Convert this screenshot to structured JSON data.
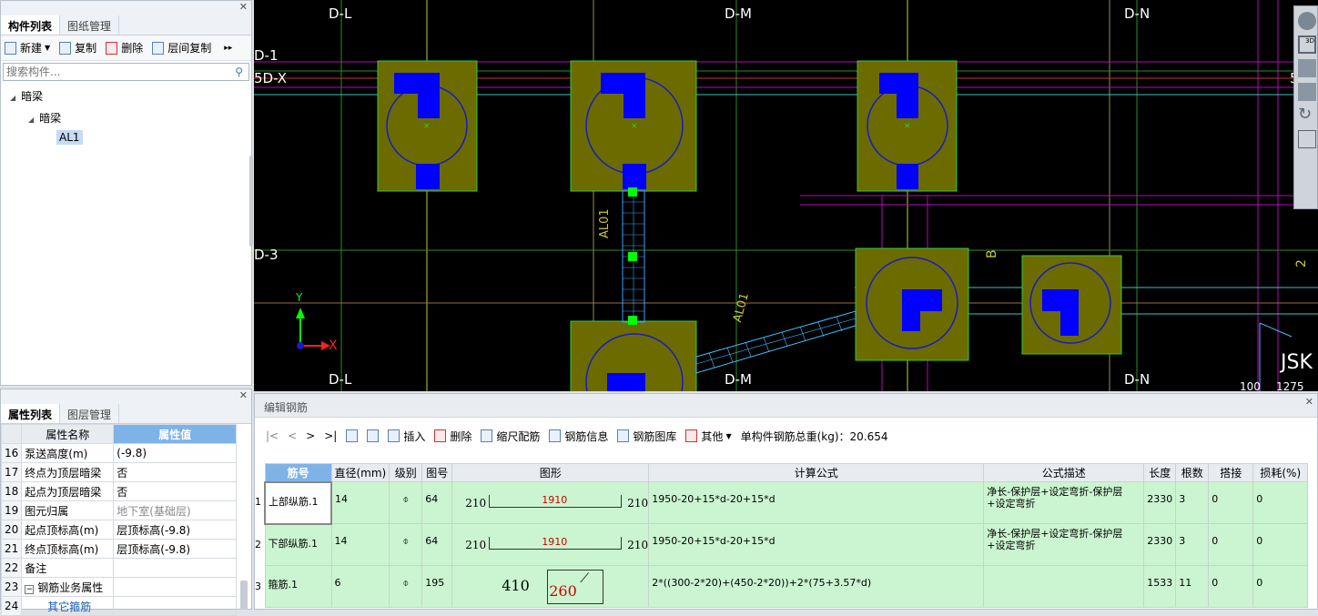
{
  "left_top": {
    "tabs": [
      "构件列表",
      "图纸管理"
    ],
    "toolbar": {
      "new": "新建",
      "copy": "复制",
      "delete": "删除",
      "floor_copy": "层间复制"
    },
    "search_placeholder": "搜索构件...",
    "tree": {
      "root": "暗梁",
      "child": "暗梁",
      "leaf": "AL1"
    }
  },
  "left_bottom": {
    "tabs": [
      "属性列表",
      "图层管理"
    ],
    "header": {
      "name": "属性名称",
      "value": "属性值"
    },
    "rows": [
      {
        "num": "16",
        "name": "泵送高度(m)",
        "value": "(-9.8)"
      },
      {
        "num": "17",
        "name": "终点为顶层暗梁",
        "value": "否"
      },
      {
        "num": "18",
        "name": "起点为顶层暗梁",
        "value": "否"
      },
      {
        "num": "19",
        "name": "图元归属",
        "value": "地下室(基础层)"
      },
      {
        "num": "20",
        "name": "起点顶标高(m)",
        "value": "层顶标高(-9.8)"
      },
      {
        "num": "21",
        "name": "终点顶标高(m)",
        "value": "层顶标高(-9.8)"
      },
      {
        "num": "22",
        "name": "备注",
        "value": ""
      },
      {
        "num": "23",
        "name": "钢筋业务属性",
        "value": ""
      },
      {
        "num": "24",
        "name": "其它箍筋",
        "value": ""
      }
    ]
  },
  "canvas": {
    "labels": {
      "dl_top": "D-L",
      "dm_top": "D-M",
      "dn_top": "D-N",
      "d1": "D-1",
      "d5x": "5D-X",
      "d3": "D-3",
      "dl_bot": "D-L",
      "dm_bot": "D-M",
      "dn_bot": "D-N",
      "al01_v": "AL01",
      "al01_d": "AL01",
      "jsk": "JSK",
      "b_mark": "B",
      "two_mark": "2",
      "five_mark": "5",
      "dim1": "100",
      "dim2": "1275",
      "axis_x": "X",
      "axis_y": "Y"
    },
    "colors": {
      "bg": "#000000",
      "pile": "#6b6b00",
      "pile_edge": "#2ecc40",
      "rebar": "#0000ff",
      "axis": "#c8c832"
    }
  },
  "editor": {
    "title": "编辑钢筋",
    "toolbar": {
      "nav": [
        "|<",
        "<",
        ">",
        ">|"
      ],
      "insert": "插入",
      "delete": "删除",
      "scale": "缩尺配筋",
      "info": "钢筋信息",
      "library": "钢筋图库",
      "other": "其他",
      "total": "单构件钢筋总重(kg)：20.654"
    },
    "columns": [
      "筋号",
      "直径(mm)",
      "级别",
      "图号",
      "图形",
      "计算公式",
      "公式描述",
      "长度",
      "根数",
      "搭接",
      "损耗(%)"
    ],
    "rows": [
      {
        "num": "1",
        "name": "上部纵筋.1",
        "dia": "14",
        "grade": "⌽",
        "fig": "64",
        "left": "210",
        "mid": "1910",
        "right": "210",
        "formula": "1950-20+15*d-20+15*d",
        "desc": "净长-保护层+设定弯折-保护层+设定弯折",
        "len": "2330",
        "count": "3",
        "lap": "0",
        "loss": "0"
      },
      {
        "num": "2",
        "name": "下部纵筋.1",
        "dia": "14",
        "grade": "⌽",
        "fig": "64",
        "left": "210",
        "mid": "1910",
        "right": "210",
        "formula": "1950-20+15*d-20+15*d",
        "desc": "净长-保护层+设定弯折-保护层+设定弯折",
        "len": "2330",
        "count": "3",
        "lap": "0",
        "loss": "0"
      },
      {
        "num": "3",
        "name": "箍筋.1",
        "dia": "6",
        "grade": "⌽",
        "fig": "195",
        "left": "410",
        "mid": "260",
        "right": "",
        "formula": "2*((300-2*20)+(450-2*20))+2*(75+3.57*d)",
        "desc": "",
        "len": "1533",
        "count": "11",
        "lap": "0",
        "loss": "0"
      }
    ]
  }
}
